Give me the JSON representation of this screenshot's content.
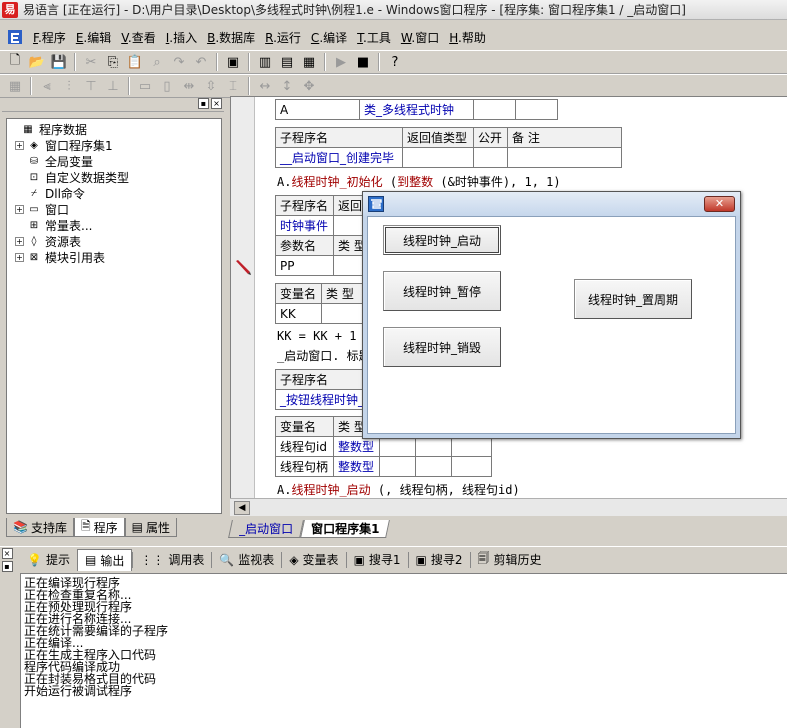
{
  "window": {
    "title": "易语言 [正在运行] - D:\\用户目录\\Desktop\\多线程式时钟\\例程1.e - Windows窗口程序 - [程序集: 窗口程序集1 / _启动窗口]"
  },
  "menu": [
    {
      "key": "F",
      "label": ".程序"
    },
    {
      "key": "E",
      "label": ".编辑"
    },
    {
      "key": "V",
      "label": ".查看"
    },
    {
      "key": "I",
      "label": ".插入"
    },
    {
      "key": "B",
      "label": ".数据库"
    },
    {
      "key": "R",
      "label": ".运行"
    },
    {
      "key": "C",
      "label": ".编译"
    },
    {
      "key": "T",
      "label": ".工具"
    },
    {
      "key": "W",
      "label": ".窗口"
    },
    {
      "key": "H",
      "label": ".帮助"
    }
  ],
  "tree": {
    "items": [
      {
        "label": "程序数据",
        "icon": "program-data-icon",
        "expander": "none",
        "indent": 0
      },
      {
        "label": "窗口程序集1",
        "icon": "module-icon",
        "expander": "+",
        "indent": 1
      },
      {
        "label": "全局变量",
        "icon": "global-var-icon",
        "expander": "none",
        "indent": 1
      },
      {
        "label": "自定义数据类型",
        "icon": "datatype-icon",
        "expander": "none",
        "indent": 1
      },
      {
        "label": "Dll命令",
        "icon": "dll-icon",
        "expander": "none",
        "indent": 1
      },
      {
        "label": "窗口",
        "icon": "window-icon",
        "expander": "+",
        "indent": 1
      },
      {
        "label": "常量表...",
        "icon": "constant-icon",
        "expander": "none",
        "indent": 1
      },
      {
        "label": "资源表",
        "icon": "resource-icon",
        "expander": "+",
        "indent": 1
      },
      {
        "label": "模块引用表",
        "icon": "module-ref-icon",
        "expander": "+",
        "indent": 1
      }
    ]
  },
  "left_tabs": [
    "支持库",
    "程序",
    "属性"
  ],
  "editor": {
    "top_row": [
      "A",
      "类_多线程式时钟"
    ],
    "sub1_header": [
      "子程序名",
      "返回值类型",
      "公开",
      "备 注"
    ],
    "sub1_name": "__启动窗口_创建完毕",
    "line1": {
      "prefix": "A.",
      "call": "线程时钟_初始化",
      "mid": " (",
      "arg": "到整数",
      "rest": " (&时钟事件), 1, 1)"
    },
    "sub2_header": [
      "子程序名",
      "返回"
    ],
    "sub2_name": "时钟事件",
    "param_header": [
      "参数名",
      "类 型"
    ],
    "param_row": [
      "PP"
    ],
    "var_header": [
      "变量名",
      "类 型"
    ],
    "var_row": [
      "KK"
    ],
    "line2": "KK = KK + 1",
    "line3": "_启动窗口. 标题",
    "sub3_header": [
      "子程序名"
    ],
    "sub3_name": "_按钮线程时钟_",
    "var3_header": [
      "变量名",
      "类 型"
    ],
    "var3_rows": [
      [
        "线程句id",
        "整数型"
      ],
      [
        "线程句柄",
        "整数型"
      ]
    ],
    "line4": {
      "prefix": "A.",
      "call": "线程时钟_启动",
      "rest": " (, 线程句柄, 线程句id)"
    }
  },
  "editor_tabs": [
    "_启动窗口",
    "窗口程序集1"
  ],
  "bottom_tabs": [
    "提示",
    "输出",
    "调用表",
    "监视表",
    "变量表",
    "搜寻1",
    "搜寻2",
    "剪辑历史"
  ],
  "output_lines": [
    "正在编译现行程序",
    "正在检查重复名称...",
    "正在预处理现行程序",
    "正在进行名称连接...",
    "正在统计需要编译的子程序",
    "正在编译...",
    "正在生成主程序入口代码",
    "程序代码编译成功",
    "正在封装易格式目的代码",
    "开始运行被调试程序"
  ],
  "run_window": {
    "close_label": "✕",
    "buttons": {
      "start": "线程时钟_启动",
      "pause": "线程时钟_暂停",
      "destroy": "线程时钟_销毁",
      "period": "线程时钟_置周期"
    }
  }
}
